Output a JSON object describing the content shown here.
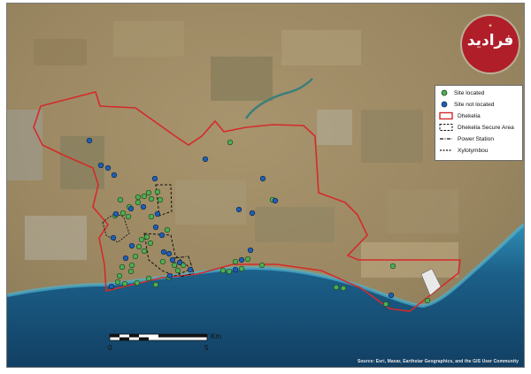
{
  "legend": {
    "items": [
      {
        "label": "Site located",
        "symbol": "green-dot",
        "color": "#4caf50"
      },
      {
        "label": "Site not located",
        "symbol": "blue-dot",
        "color": "#1f5fb4"
      },
      {
        "label": "Dhekelia",
        "symbol": "red-outline-box",
        "color": "#d42b2b"
      },
      {
        "label": "Dhekelia Secure Area",
        "symbol": "dashed-box",
        "color": "#111111"
      },
      {
        "label": "Power Station",
        "symbol": "dash-dot-line",
        "color": "#111111"
      },
      {
        "label": "Xylotymbou",
        "symbol": "dashed-line",
        "color": "#111111"
      }
    ]
  },
  "scale": {
    "start": "0",
    "end": "5",
    "unit": "Km"
  },
  "credits": "Source: Esri, Maxar, Earthstar Geographics, and the GIS User Community",
  "logo": {
    "text": "فرادید",
    "icon": "faradid-logo"
  },
  "colors": {
    "boundary": "#d42b2b",
    "located": "#4caf50",
    "not_located": "#1f5fb4",
    "sea": "#1c5f86"
  },
  "sites_located_count": 47,
  "sites_not_located_count": 30
}
